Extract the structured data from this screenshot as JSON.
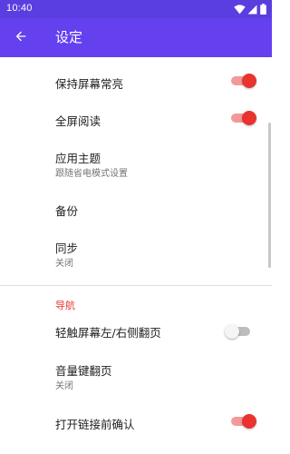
{
  "status_bar": {
    "time": "10:40",
    "icons": [
      "wifi-icon",
      "signal-icon",
      "battery-icon"
    ]
  },
  "app_bar": {
    "title": "设定",
    "back_icon": "arrow-back-icon"
  },
  "colors": {
    "status_bar": "#5b3ee0",
    "app_bar": "#6440ef",
    "accent": "#e8332e",
    "category": "#e53935"
  },
  "settings": {
    "keep_screen_on": {
      "title": "保持屏幕常亮",
      "checked": true
    },
    "fullscreen_read": {
      "title": "全屏阅读",
      "checked": true
    },
    "app_theme": {
      "title": "应用主题",
      "summary": "跟随省电模式设置"
    },
    "backup": {
      "title": "备份"
    },
    "sync": {
      "title": "同步",
      "summary": "关闭"
    }
  },
  "navigation": {
    "category_label": "导航",
    "tap_flip": {
      "title": "轻触屏幕左/右侧翻页",
      "checked": false
    },
    "volume_flip": {
      "title": "音量键翻页",
      "summary": "关闭"
    },
    "confirm_link": {
      "title": "打开链接前确认",
      "checked": true
    }
  }
}
